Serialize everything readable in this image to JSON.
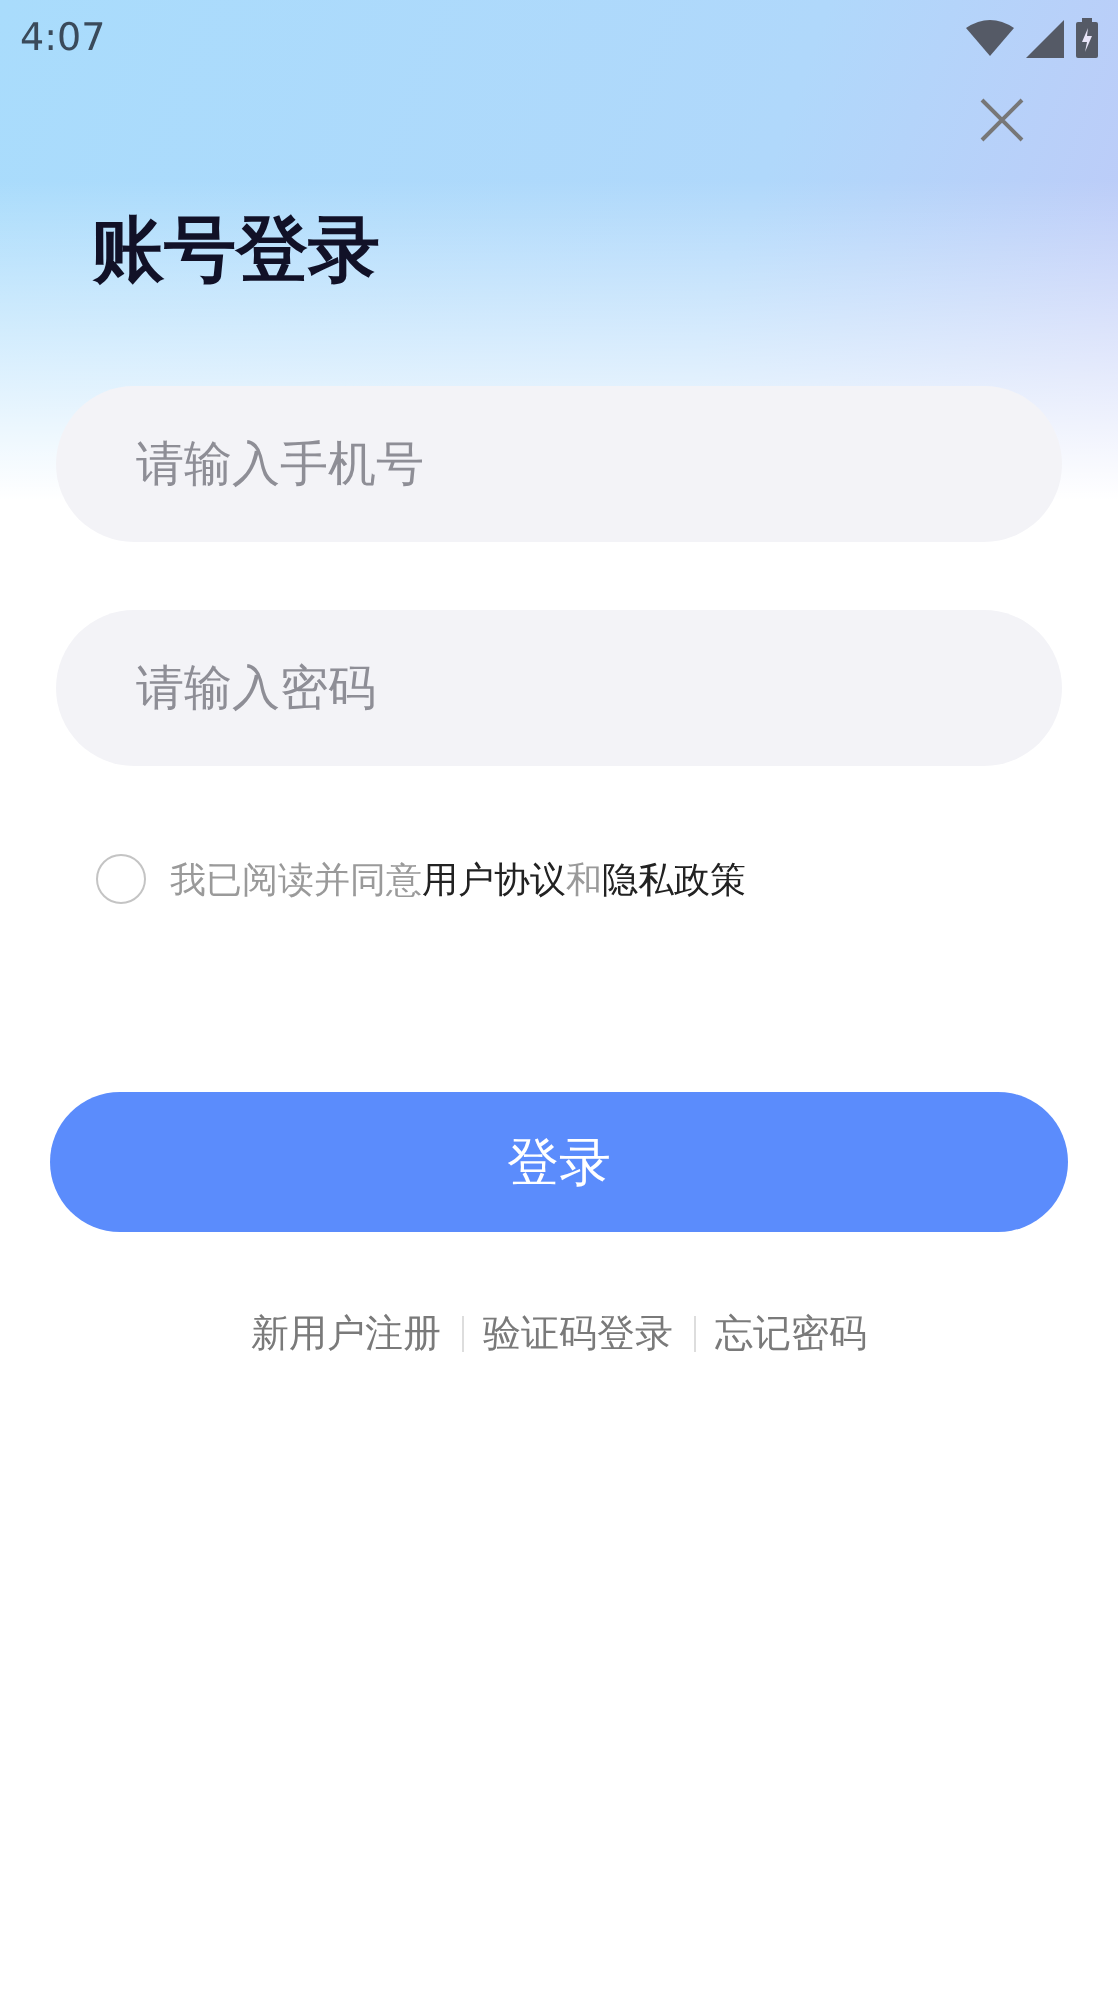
{
  "status_bar": {
    "time": "4:07"
  },
  "title": "账号登录",
  "fields": [
    {
      "placeholder": "请输入手机号"
    },
    {
      "placeholder": "请输入密码"
    }
  ],
  "agreement": {
    "checked": false,
    "parts": [
      {
        "text": "我已阅读并同意",
        "kind": "plain"
      },
      {
        "text": "用户协议",
        "kind": "link"
      },
      {
        "text": "和",
        "kind": "plain"
      },
      {
        "text": "隐私政策",
        "kind": "link"
      }
    ]
  },
  "login_button": "登录",
  "links": [
    "新用户注册",
    "验证码登录",
    "忘记密码"
  ]
}
